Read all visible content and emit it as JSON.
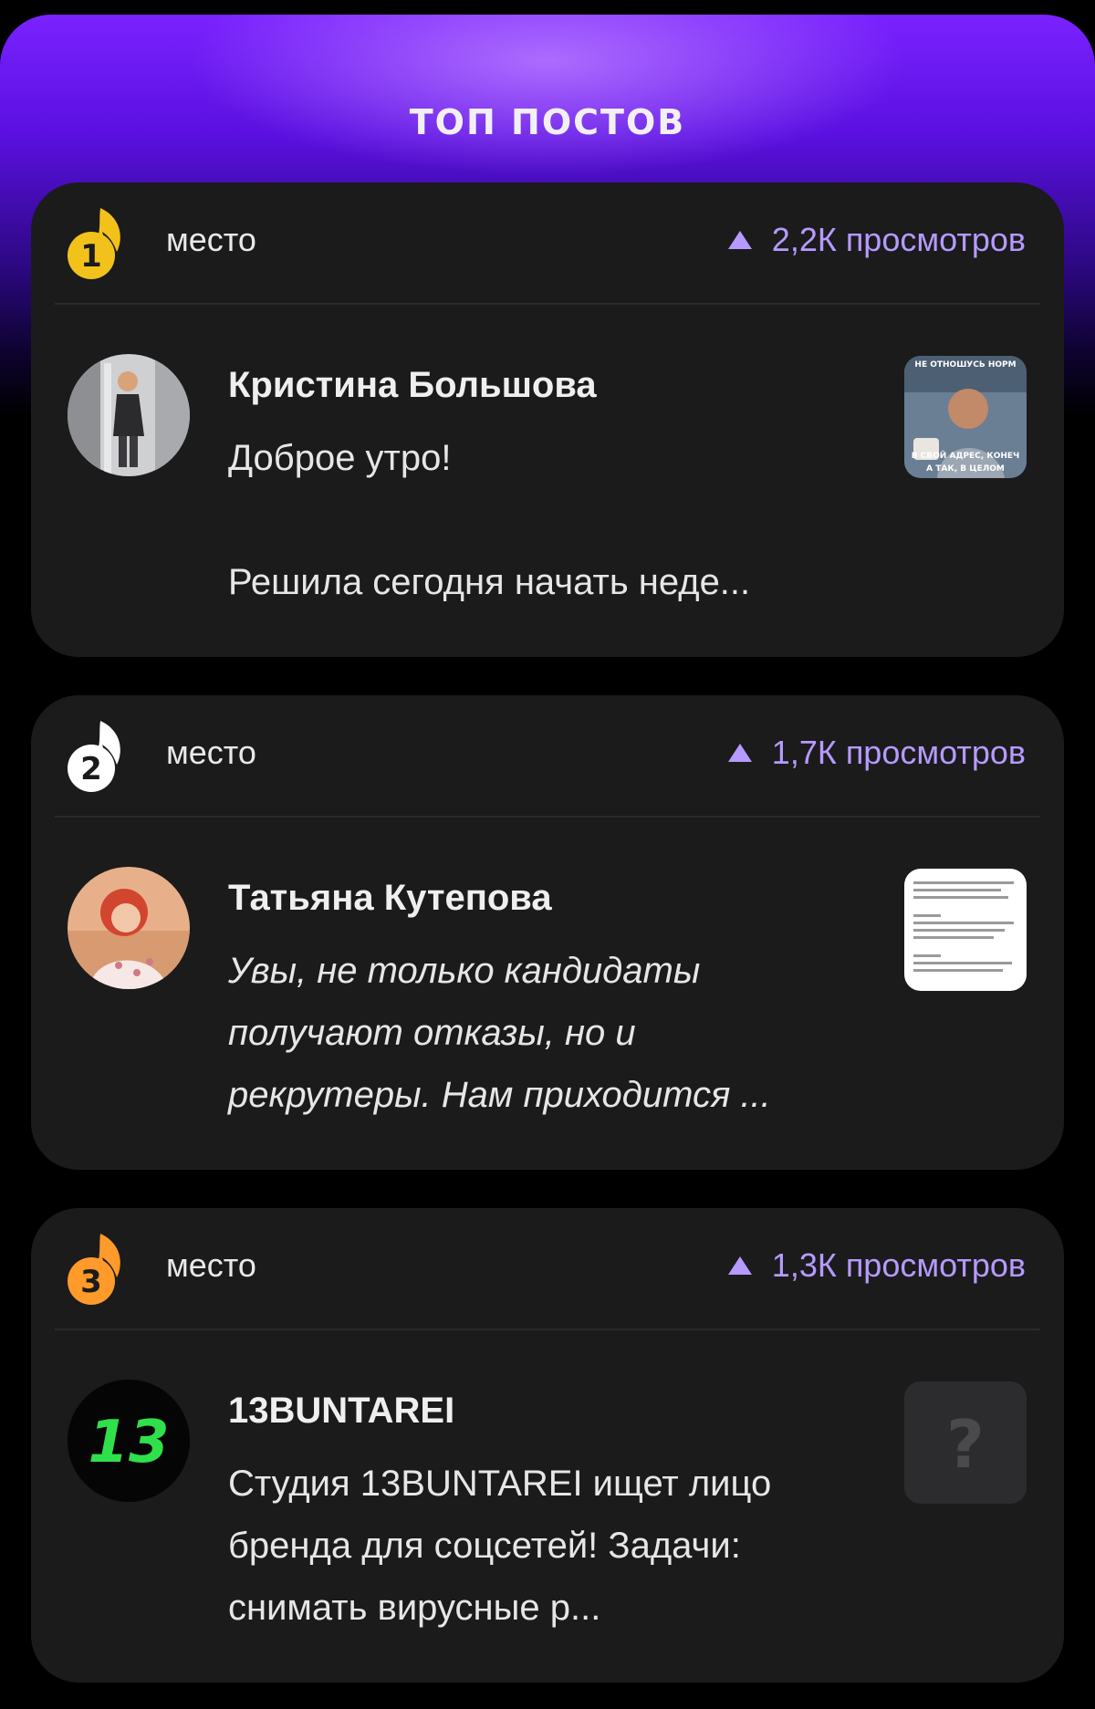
{
  "header": {
    "title": "ТОП ПОСТОВ"
  },
  "posts": [
    {
      "rank": "1",
      "place_label": "место",
      "views": "2,2К просмотров",
      "medal_color": "#f2c21b",
      "author": "Кристина Большова",
      "snippet": "Доброе утро!\n\nРешила сегодня начать неде...",
      "thumbnail_caption_top": "НЕ ОТНОШУСЬ НОРМ",
      "thumbnail_caption_bottom": "В СВОЙ АДРЕС, КОНЕЧ",
      "thumbnail_caption_bottom2": "А ТАК, В ЦЕЛОМ"
    },
    {
      "rank": "2",
      "place_label": "место",
      "views": "1,7К просмотров",
      "medal_color": "#ffffff",
      "author": "Татьяна Кутепова",
      "snippet": "Увы, не только кандидаты получают отказы, но и рекрутеры. Нам приходится ..."
    },
    {
      "rank": "3",
      "place_label": "место",
      "views": "1,3К просмотров",
      "medal_color": "#ff9a2b",
      "author": "13BUNTAREI",
      "snippet": "Студия 13BUNTAREI ищет лицо бренда для соцсетей! Задачи: снимать вирусные р...",
      "avatar_text": "13",
      "thumbnail_icon": "?"
    }
  ],
  "colors": {
    "accent": "#b69aff",
    "card_bg": "#1b1b1c",
    "hero_purple": "#7a22ff"
  }
}
